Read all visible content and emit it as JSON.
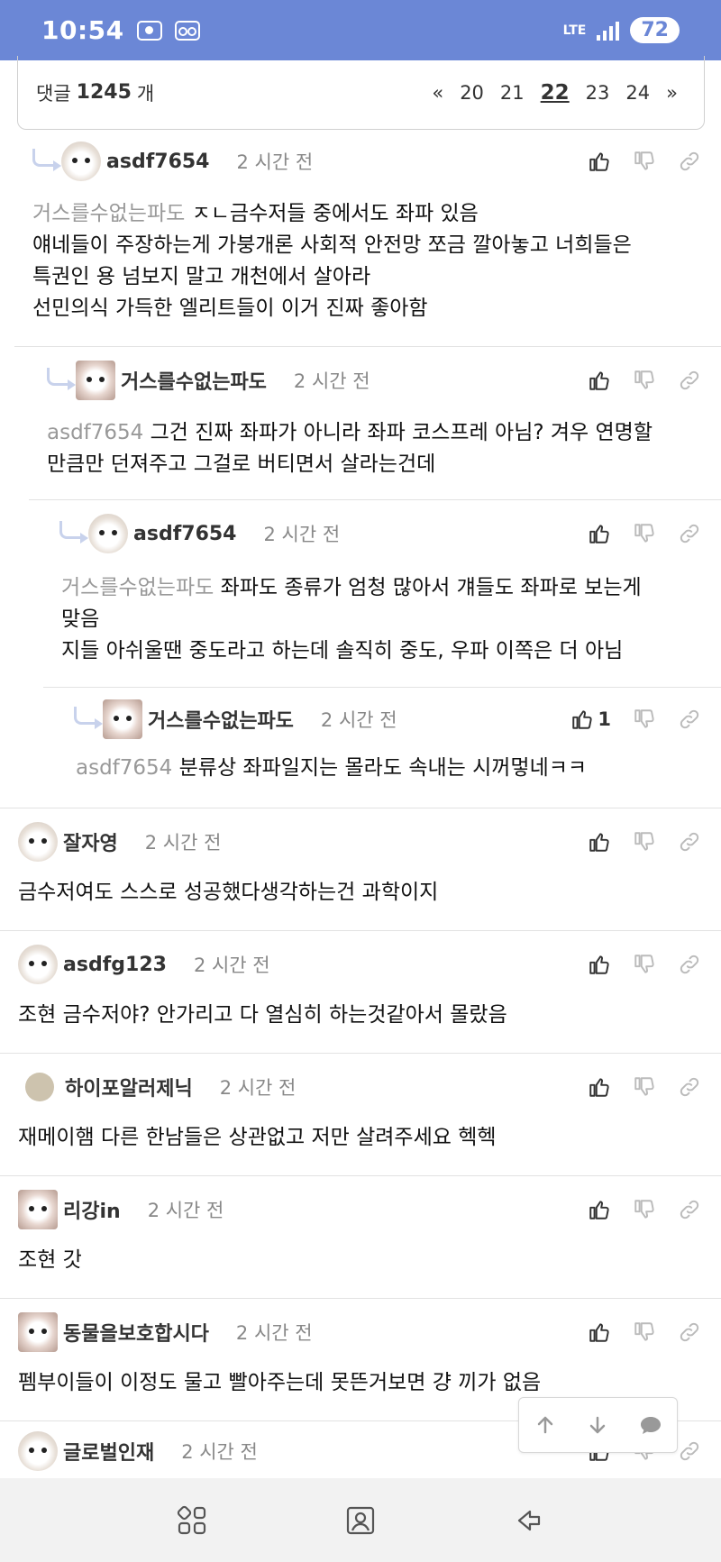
{
  "status_bar": {
    "time": "10:54",
    "network": "LTE",
    "battery": "72"
  },
  "pager": {
    "label_prefix": "댓글",
    "count": "1245",
    "label_suffix": "개",
    "first": "«",
    "pages": [
      "20",
      "21",
      "22",
      "23",
      "24"
    ],
    "current": "22",
    "last": "»"
  },
  "comments": [
    {
      "author": "asdf7654",
      "time": "2 시간 전",
      "reply": true,
      "likes": "",
      "mention": "거스를수없는파도",
      "lines": [
        "ㅈㄴ금수저들 중에서도 좌파 있음",
        "얘네들이 주장하는게 가붕개론 사회적 안전망 쪼금 깔아놓고 너희들은",
        "특권인 용 넘보지 말고 개천에서 살아라",
        "선민의식 가득한 엘리트들이 이거 진짜 좋아함"
      ]
    },
    {
      "author": "거스를수없는파도",
      "time": "2 시간 전",
      "reply": true,
      "likes": "",
      "mention": "asdf7654",
      "lines": [
        "그건 진짜 좌파가 아니라 좌파 코스프레 아님? 겨우 연명할",
        "만큼만 던져주고 그걸로 버티면서 살라는건데"
      ]
    },
    {
      "author": "asdf7654",
      "time": "2 시간 전",
      "reply": true,
      "likes": "",
      "mention": "거스를수없는파도",
      "lines": [
        "좌파도 종류가 엄청 많아서 걔들도 좌파로 보는게",
        "맞음",
        "지들 아쉬울땐 중도라고 하는데 솔직히 중도, 우파 이쪽은 더 아님"
      ]
    },
    {
      "author": "거스를수없는파도",
      "time": "2 시간 전",
      "reply": true,
      "likes": "1",
      "mention": "asdf7654",
      "lines": [
        "분류상 좌파일지는 몰라도 속내는 시꺼멓네ㅋㅋ"
      ]
    },
    {
      "author": "잘자영",
      "time": "2 시간 전",
      "reply": false,
      "likes": "",
      "mention": "",
      "lines": [
        "금수저여도 스스로 성공했다생각하는건 과학이지"
      ]
    },
    {
      "author": "asdfg123",
      "time": "2 시간 전",
      "reply": false,
      "likes": "",
      "mention": "",
      "lines": [
        "조현 금수저야? 안가리고 다 열심히 하는것같아서 몰랐음"
      ]
    },
    {
      "author": "하이포알러제닉",
      "time": "2 시간 전",
      "reply": false,
      "likes": "",
      "mention": "",
      "lines": [
        "재메이햄 다른 한남들은 상관없고 저만 살려주세요 헥헥"
      ]
    },
    {
      "author": "리강in",
      "time": "2 시간 전",
      "reply": false,
      "likes": "",
      "mention": "",
      "lines": [
        "조현 갓"
      ]
    },
    {
      "author": "동물을보호합시다",
      "time": "2 시간 전",
      "reply": false,
      "likes": "",
      "mention": "",
      "lines": [
        "펨부이들이 이정도 물고 빨아주는데 못뜬거보면 걍 끼가 없음"
      ]
    },
    {
      "author": "글로벌인재",
      "time": "2 시간 전",
      "reply": false,
      "likes": "",
      "mention": "",
      "lines": []
    }
  ],
  "icons": {
    "like": "thumbs-up-icon",
    "dislike": "thumbs-down-icon",
    "link": "link-icon",
    "scroll_up": "arrow-up-icon",
    "scroll_down": "arrow-down-icon",
    "comment": "comment-bubble-icon",
    "nav_recent": "recent-apps-icon",
    "nav_home": "home-portrait-icon",
    "nav_back": "back-icon"
  },
  "colors": {
    "status_bar": "#6b87d6",
    "mention": "#999999",
    "reply_arrow": "#c8d2ec"
  }
}
